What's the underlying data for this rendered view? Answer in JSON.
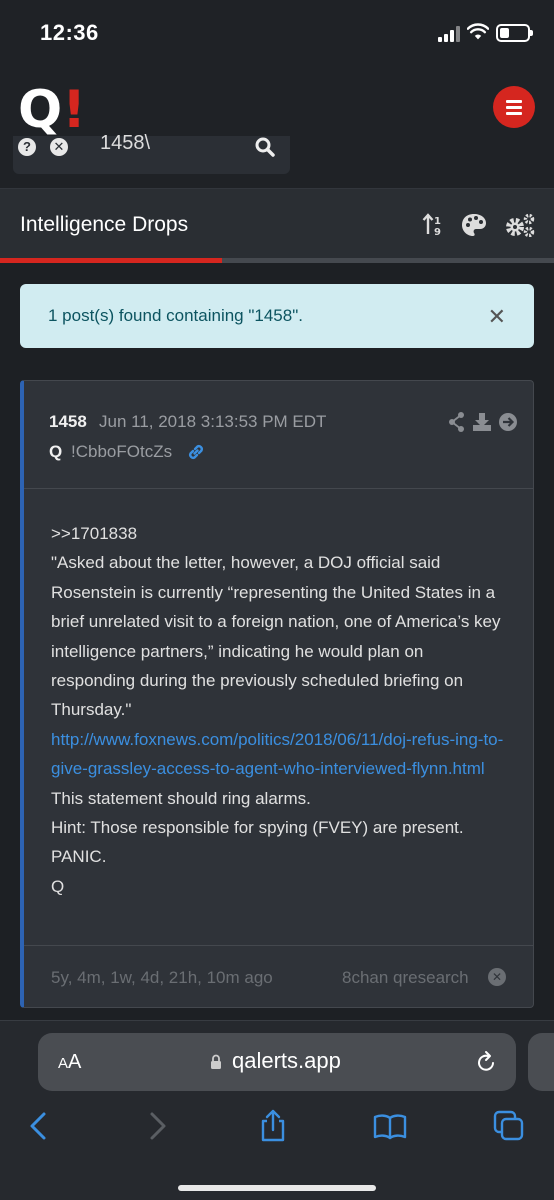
{
  "status_bar": {
    "time": "12:36",
    "battery_level": 0.35
  },
  "header": {
    "logo_q": "Q",
    "logo_bang": "!",
    "search": {
      "value": "1458\\"
    }
  },
  "section": {
    "title": "Intelligence Drops",
    "progress_fraction": 0.4
  },
  "alert": {
    "message": "1 post(s) found containing \"1458\".",
    "close_symbol": "✕"
  },
  "post": {
    "number": "1458",
    "date": "Jun 11, 2018 3:13:53 PM EDT",
    "author": "Q",
    "tripcode": "!CbboFOtcZs",
    "body": [
      ">>1701838",
      "\"Asked about the letter, however, a DOJ official said Rosenstein is currently “representing the United States in a brief unrelated visit to a foreign nation, one of America’s key intelligence partners,” indicating he would plan on responding during the previously scheduled briefing on Thursday.\""
    ],
    "link": "http://www.foxnews.com/politics/2018/06/11/doj-refus-ing-to-give-grassley-access-to-agent-who-interviewed-flynn.html",
    "body_after": [
      "This statement should ring alarms.",
      "Hint: Those responsible for spying (FVEY) are present.",
      "PANIC.",
      "Q"
    ],
    "time_ago": "5y, 4m, 1w, 4d, 21h, 10m ago",
    "board": "8chan qresearch"
  },
  "safari": {
    "aa_label_small": "A",
    "aa_label_large": "A",
    "url": "qalerts.app"
  },
  "icons": {
    "help": "question-icon",
    "clear": "close-circle-icon",
    "search": "search-icon",
    "sort": "sort-icon",
    "palette": "palette-icon",
    "settings": "gears-icon",
    "share": "share-icon",
    "download": "download-icon",
    "goto": "arrow-circle-icon",
    "link": "link-icon"
  },
  "colors": {
    "accent_red": "#d5261f",
    "link_blue": "#3b8fe0",
    "card_border_blue": "#2d63b3"
  }
}
